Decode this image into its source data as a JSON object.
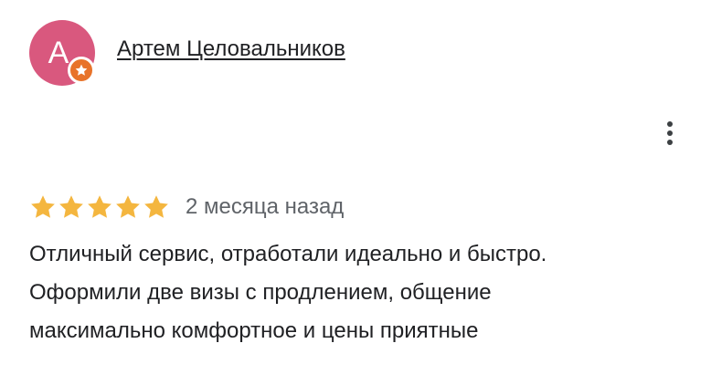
{
  "reviewer": {
    "initial": "А",
    "name": "Артем Целовальников",
    "avatar_color": "#d9587e",
    "badge_color": "#e8732a",
    "badge_icon": "star-badge-icon"
  },
  "menu": {
    "icon": "more-vert-icon"
  },
  "review": {
    "rating": 5,
    "rating_max": 5,
    "star_color": "#f4b63f",
    "date": "2 месяца назад",
    "text": "Отличный сервис, отработали идеально и быстро.\nОформили две визы с продлением, общение\nмаксимально комфортное и цены приятные"
  }
}
